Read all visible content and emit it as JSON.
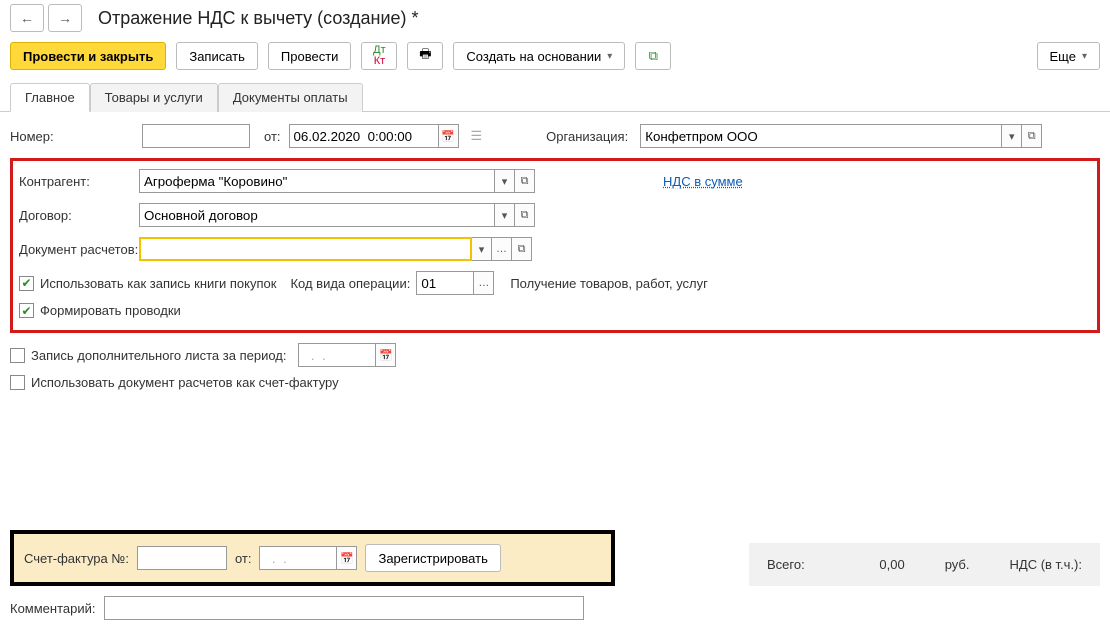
{
  "title": "Отражение НДС к вычету (создание) *",
  "toolbar": {
    "post_and_close": "Провести и закрыть",
    "save": "Записать",
    "post": "Провести",
    "create_based_on": "Создать на основании",
    "more": "Еще"
  },
  "tabs": {
    "main": "Главное",
    "goods": "Товары и услуги",
    "paydocs": "Документы оплаты"
  },
  "header": {
    "number_label": "Номер:",
    "date_label": "от:",
    "date_value": "06.02.2020  0:00:00",
    "org_label": "Организация:",
    "org_value": "Конфетпром ООО"
  },
  "red": {
    "counterparty_label": "Контрагент:",
    "counterparty_value": "Агроферма \"Коровино\"",
    "nds_link": "НДС в сумме",
    "contract_label": "Договор:",
    "contract_value": "Основной договор",
    "settle_doc_label": "Документ расчетов:",
    "settle_doc_value": "",
    "chk_purchase_book": "Использовать как запись книги покупок",
    "op_code_label": "Код вида операции:",
    "op_code_value": "01",
    "op_code_desc": "Получение товаров, работ, услуг",
    "chk_gen_entries": "Формировать проводки"
  },
  "other": {
    "chk_extra_sheet": "Запись дополнительного листа за период:",
    "extra_date": "  .  .    ",
    "chk_use_doc_as_invoice": "Использовать документ расчетов как счет-фактуру"
  },
  "invoice": {
    "label": "Счет-фактура №:",
    "num": "",
    "from_label": "от:",
    "from_value": "  .  .    ",
    "register": "Зарегистрировать"
  },
  "totals": {
    "total_label": "Всего:",
    "total_value": "0,00",
    "currency": "руб.",
    "nds_label": "НДС (в т.ч.):"
  },
  "comment_label": "Комментарий:"
}
